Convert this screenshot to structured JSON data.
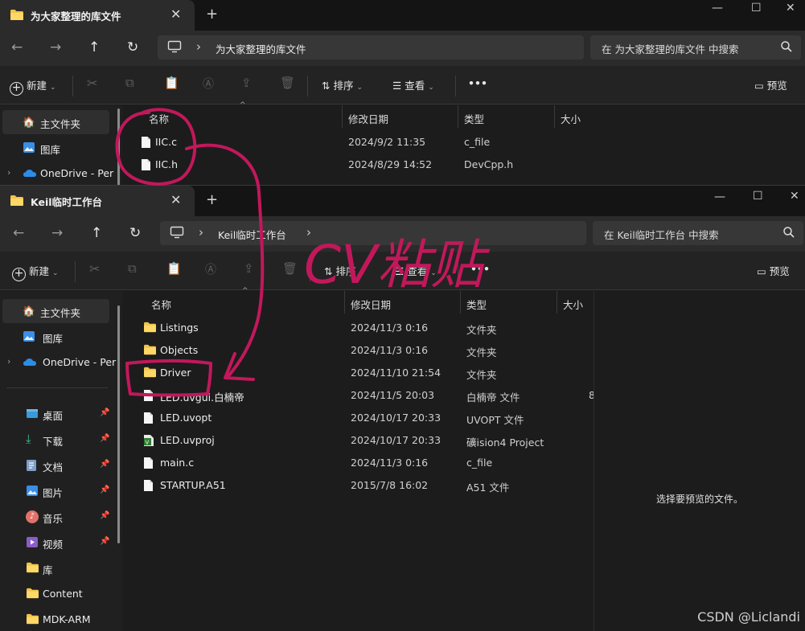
{
  "back_window": {
    "tab_title": "为大家整理的库文件",
    "new_tab_symbol": "+",
    "address_crumb": "为大家整理的库文件",
    "search_placeholder": "在 为大家整理的库文件 中搜索",
    "commands": {
      "new": "新建",
      "sort": "排序",
      "view": "查看",
      "more": "•••",
      "preview": "预览"
    },
    "sidebar": [
      {
        "label": "主文件夹",
        "icon": "home-icon",
        "selected": true
      },
      {
        "label": "图库",
        "icon": "gallery-icon"
      },
      {
        "label": "OneDrive - Per",
        "icon": "onedrive-icon",
        "expandable": true
      }
    ],
    "columns": {
      "name": "名称",
      "date": "修改日期",
      "type": "类型",
      "size": "大小"
    },
    "files": [
      {
        "name": "IIC.c",
        "date": "2024/9/2 11:35",
        "type": "c_file",
        "icon": "file-icon"
      },
      {
        "name": "IIC.h",
        "date": "2024/8/29 14:52",
        "type": "DevCpp.h",
        "icon": "file-icon"
      }
    ]
  },
  "front_window": {
    "tab_title": "Keil临时工作台",
    "new_tab_symbol": "+",
    "address_crumb": "Keil临时工作台",
    "search_placeholder": "在 Keil临时工作台 中搜索",
    "commands": {
      "new": "新建",
      "sort": "排序",
      "view": "查看",
      "more": "•••",
      "preview": "预览"
    },
    "sidebar_top": [
      {
        "label": "主文件夹",
        "icon": "home-icon",
        "selected": true
      },
      {
        "label": "图库",
        "icon": "gallery-icon"
      },
      {
        "label": "OneDrive - Per",
        "icon": "onedrive-icon",
        "expandable": true
      }
    ],
    "sidebar_quick": [
      {
        "label": "桌面",
        "icon": "desktop-icon",
        "pinned": true
      },
      {
        "label": "下载",
        "icon": "download-icon",
        "pinned": true
      },
      {
        "label": "文档",
        "icon": "documents-icon",
        "pinned": true
      },
      {
        "label": "图片",
        "icon": "pictures-icon",
        "pinned": true
      },
      {
        "label": "音乐",
        "icon": "music-icon",
        "pinned": true
      },
      {
        "label": "视频",
        "icon": "videos-icon",
        "pinned": true
      },
      {
        "label": "库",
        "icon": "folder-icon"
      },
      {
        "label": "Content",
        "icon": "folder-icon"
      },
      {
        "label": "MDK-ARM",
        "icon": "folder-icon"
      }
    ],
    "columns": {
      "name": "名称",
      "date": "修改日期",
      "type": "类型",
      "size": "大小"
    },
    "files": [
      {
        "name": "Listings",
        "date": "2024/11/3 0:16",
        "type": "文件夹",
        "icon": "folder-icon",
        "size": ""
      },
      {
        "name": "Objects",
        "date": "2024/11/3 0:16",
        "type": "文件夹",
        "icon": "folder-icon",
        "size": ""
      },
      {
        "name": "Driver",
        "date": "2024/11/10 21:54",
        "type": "文件夹",
        "icon": "folder-icon",
        "size": ""
      },
      {
        "name": "LED.uvgui.白楠帝",
        "date": "2024/11/5 20:03",
        "type": "白楠帝 文件",
        "icon": "file-icon",
        "size": "8"
      },
      {
        "name": "LED.uvopt",
        "date": "2024/10/17 20:33",
        "type": "UVOPT 文件",
        "icon": "file-icon",
        "size": ""
      },
      {
        "name": "LED.uvproj",
        "date": "2024/10/17 20:33",
        "type": "礦ision4 Project",
        "icon": "uvproj-icon",
        "size": ""
      },
      {
        "name": "main.c",
        "date": "2024/11/3 0:16",
        "type": "c_file",
        "icon": "file-icon",
        "size": ""
      },
      {
        "name": "STARTUP.A51",
        "date": "2015/7/8 16:02",
        "type": "A51 文件",
        "icon": "file-icon",
        "size": ""
      }
    ],
    "preview_text": "选择要预览的文件。"
  },
  "annotation": {
    "text": "CV粘贴",
    "color": "#c2185b"
  },
  "watermark": "CSDN @Liclandi",
  "colors": {
    "accent_blue": "#4cc2ff",
    "folder_yellow": "#f4c24b",
    "ink_magenta": "#c2185b"
  }
}
